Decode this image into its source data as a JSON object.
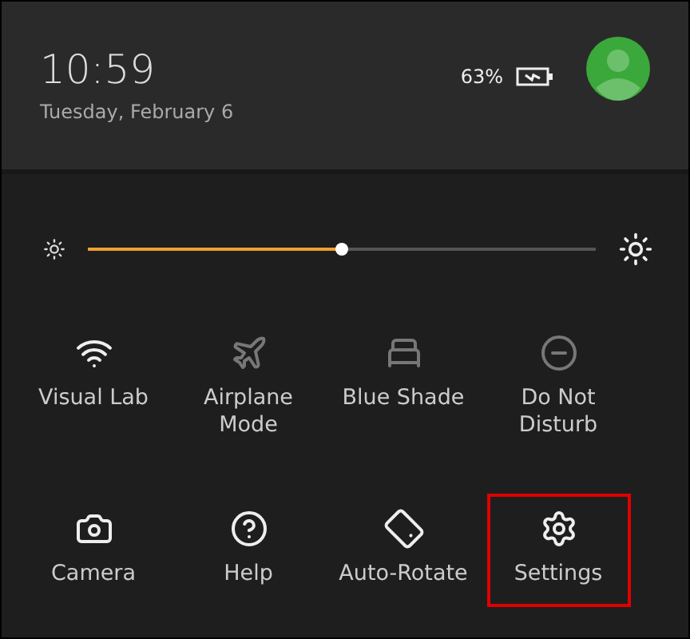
{
  "status": {
    "time": "10:59",
    "date": "Tuesday, February 6",
    "battery": "63%"
  },
  "brightness": {
    "level": 0.5
  },
  "tiles": [
    {
      "kind": "wifi",
      "label": "Visual Lab",
      "on": true,
      "highlighted": false
    },
    {
      "kind": "airplane",
      "label": "Airplane Mode",
      "on": false,
      "highlighted": false
    },
    {
      "kind": "blue-shade",
      "label": "Blue Shade",
      "on": false,
      "highlighted": false
    },
    {
      "kind": "do-not-disturb",
      "label": "Do Not Disturb",
      "on": false,
      "highlighted": false
    },
    {
      "kind": "camera",
      "label": "Camera",
      "on": true,
      "highlighted": false
    },
    {
      "kind": "help",
      "label": "Help",
      "on": true,
      "highlighted": false
    },
    {
      "kind": "rotate",
      "label": "Auto-Rotate",
      "on": true,
      "highlighted": false
    },
    {
      "kind": "settings",
      "label": "Settings",
      "on": true,
      "highlighted": true
    }
  ]
}
